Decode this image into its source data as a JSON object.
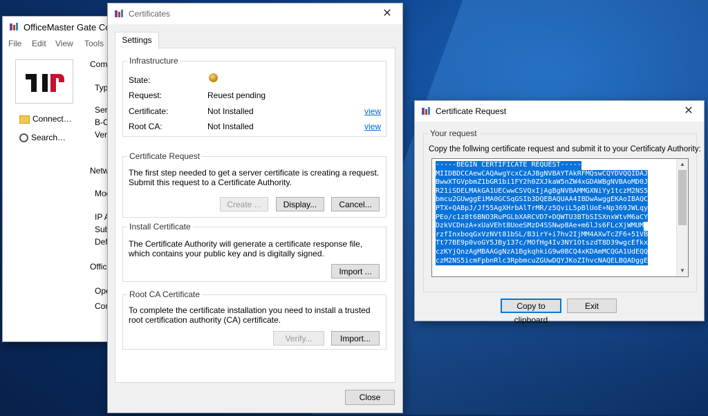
{
  "back_window": {
    "title": "OfficeMaster Gate Conf",
    "menu": [
      "File",
      "Edit",
      "View",
      "Tools"
    ],
    "side_links": [
      "Connect…",
      "Search…"
    ],
    "truncated_labels": [
      "Comm",
      "Type",
      "Seri",
      "B-Ch",
      "Vers",
      "Netw",
      "Mod",
      "IP A",
      "Sub",
      "Defa",
      "Office",
      "Ope",
      "Con"
    ]
  },
  "certificates": {
    "title": "Certificates",
    "tab": "Settings",
    "infrastructure": {
      "title": "Infrastructure",
      "rows": [
        {
          "label": "State:",
          "value": ""
        },
        {
          "label": "Request:",
          "value": "Reuest pending"
        },
        {
          "label": "Certificate:",
          "value": "Not Installed",
          "link": "view"
        },
        {
          "label": "Root CA:",
          "value": "Not Installed",
          "link": "view"
        }
      ]
    },
    "cert_request": {
      "title": "Certificate Request",
      "text": "The first step needed to get a server certificate is creating a request. Submit this request to a Certificate Authority.",
      "create": "Create ...",
      "display": "Display...",
      "cancel": "Cancel..."
    },
    "install": {
      "title": "Install Certificate",
      "text": "The Certificate Authority will generate a certificate response file, which contains your public key and is digitally signed.",
      "import": "Import ..."
    },
    "rootca": {
      "title": "Root CA Certificate",
      "text": "To complete the certificate installation you need to install a trusted root certification authority (CA) certificate.",
      "verify": "Verify...",
      "import": "Import..."
    },
    "close": "Close"
  },
  "request": {
    "title": "Certificate Request",
    "group_title": "Your request",
    "instruction": "Copy the follwing certificate request and submit it to your Certificaty Authority:",
    "lines": [
      "-----BEGIN CERTIFICATE REQUEST-----",
      "MIIDBDCCAewCAQAwgYcxCzAJBgNVBAYTAkRFMQswCQYDVQQIDAJ",
      "BwwXTGVpbmZ1bGR1bi1FY2h0ZXJkaW5nZW4xGDAWBgNVBAoMD0J",
      "R21iSDELMAkGA1UECwwCSVQxIjAgBgNVBAMMGXNiYy1tczM2NS5",
      "bmcu2GUwggEiMA0GCSqGSIb3DQEBAQUAA4IBDwAwggEKAoIBAQC",
      "PTX+QABpJ/Jf55AgXHrbAlTrMR/z5QviL5pBlUoE+Np369JWLqy",
      "PEo/c1z8t6BNO3RuPGLbXARCVD7+DQWTU3BTbSISXnxWtvM6aCY",
      "DzkVCDnzA+xUaVEht8UoeSMzD4SSNwp8Ae+m6lJs6FLcXjWMUM",
      "rzfInxboqGxVzNVt81bSL/B3irY+i7hv2IjMM4AXwTcZF6+51VB",
      "Tt77BE9p0voGY5JBy137c/MOfHg4Iv3NY1OtszdT8D39wgcEfkx",
      "czKYjQnzAgMBAAGgNzA1BgkqhkiG9w0BCQ4xKDAmMCQGA1UdEQQ",
      "czM2NS5icmFpbnRlc3RpbmcuZGUwDQYJKoZIhvcNAQELBQADggE"
    ],
    "copy": "Copy to clipboard",
    "exit": "Exit"
  }
}
